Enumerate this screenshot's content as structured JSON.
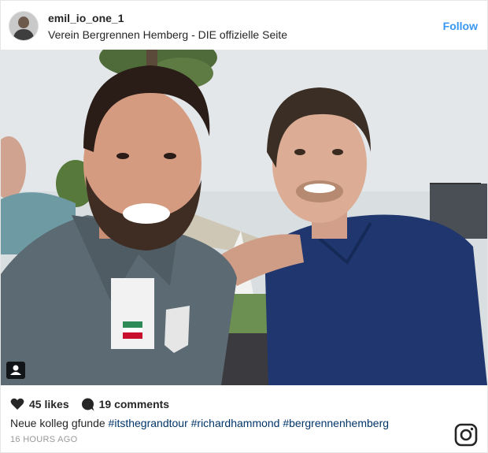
{
  "post": {
    "username": "emil_io_one_1",
    "location": "Verein Bergrennen Hemberg - DIE offizielle Seite",
    "follow_label": "Follow",
    "likes": "45 likes",
    "comments": "19 comments",
    "caption_text": "Neue kolleg gfunde",
    "hashtags": [
      "#itsthegrandtour",
      "#richardhammond",
      "#bergrennenhemberg"
    ],
    "timestamp": "16 HOURS AGO"
  },
  "icons": {
    "heart": "heart-icon",
    "comment": "comment-icon",
    "user_tag": "user-tag-icon",
    "logo": "instagram-logo-icon"
  },
  "colors": {
    "accent": "#3897f0",
    "hashtag": "#003569",
    "muted": "#999999",
    "text": "#262626"
  }
}
